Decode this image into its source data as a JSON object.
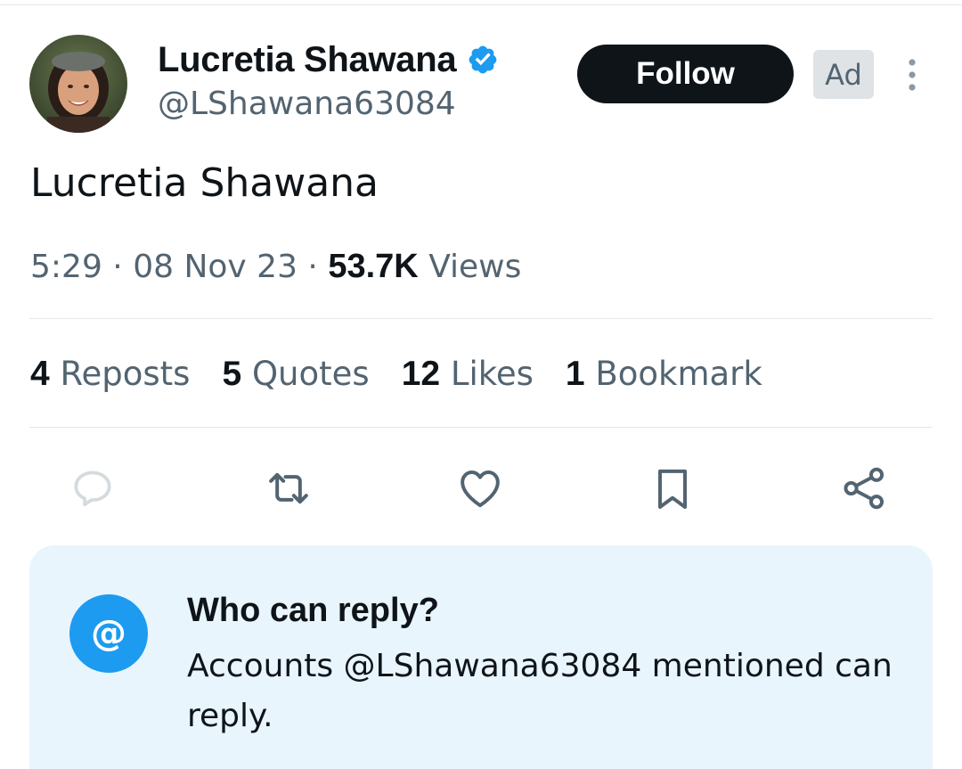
{
  "post": {
    "author": {
      "display_name": "Lucretia Shawana",
      "handle": "@LShawana63084",
      "verified": true,
      "verified_color": "#1d9bf0"
    },
    "follow_label": "Follow",
    "ad_label": "Ad",
    "text": "Lucretia Shawana",
    "meta": {
      "time": "5:29",
      "date": "08 Nov 23",
      "separator": "·",
      "views_count": "53.7K",
      "views_label": "Views"
    },
    "stats": [
      {
        "count": "4",
        "label": "Reposts"
      },
      {
        "count": "5",
        "label": "Quotes"
      },
      {
        "count": "12",
        "label": "Likes"
      },
      {
        "count": "1",
        "label": "Bookmark"
      }
    ],
    "actions": [
      "reply-icon",
      "repost-icon",
      "like-icon",
      "bookmark-icon",
      "share-icon"
    ]
  },
  "reply_settings": {
    "title": "Who can reply?",
    "description": "Accounts @LShawana63084 mentioned can reply.",
    "badge_glyph": "@",
    "badge_color": "#1d9bf0",
    "background": "#e8f5fd"
  },
  "colors": {
    "text_primary": "#0f1419",
    "text_secondary": "#536471",
    "divider": "#e4e8eb"
  }
}
